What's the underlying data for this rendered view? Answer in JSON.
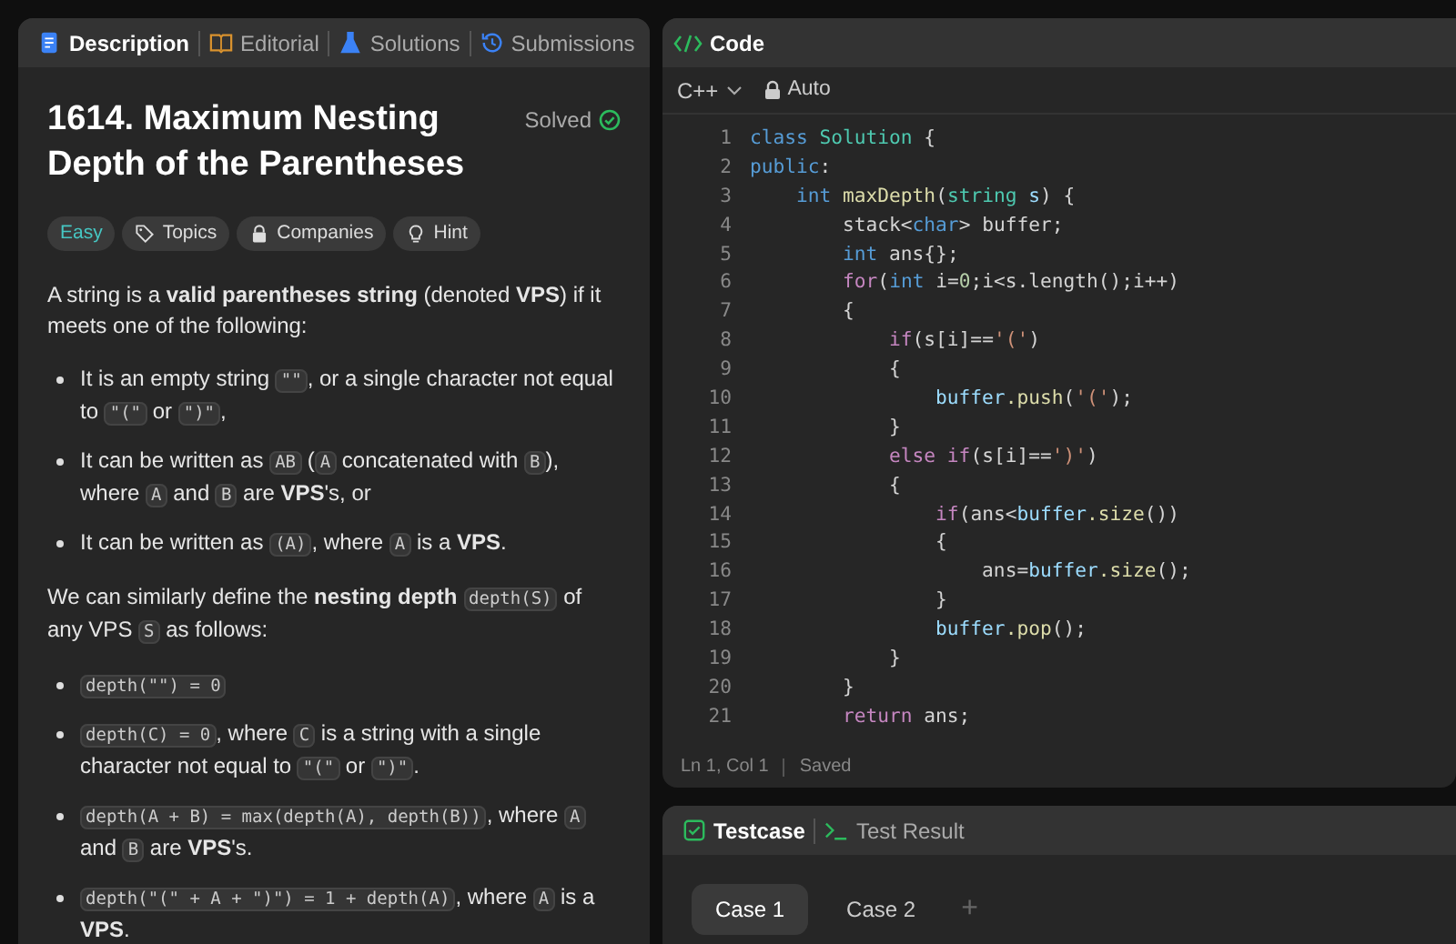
{
  "left_panel": {
    "tabs": [
      {
        "label": "Description",
        "selected": true
      },
      {
        "label": "Editorial",
        "selected": false
      },
      {
        "label": "Solutions",
        "selected": false
      },
      {
        "label": "Submissions",
        "selected": false
      }
    ],
    "title": "1614. Maximum Nesting Depth of the Parentheses",
    "status": "Solved",
    "tags": [
      {
        "label": "Easy",
        "kind": "difficulty"
      },
      {
        "label": "Topics",
        "kind": "tag"
      },
      {
        "label": "Companies",
        "kind": "lock"
      },
      {
        "label": "Hint",
        "kind": "bulb"
      }
    ],
    "description": [
      {
        "kind": "para",
        "segments": [
          {
            "kind": "text",
            "t": "A string is a "
          },
          {
            "kind": "bold",
            "t": "valid parentheses string"
          },
          {
            "kind": "text",
            "t": " (denoted "
          },
          {
            "kind": "bold",
            "t": "VPS"
          },
          {
            "kind": "text",
            "t": ") if it meets one of the following:"
          }
        ]
      },
      {
        "kind": "list",
        "items": [
          [
            {
              "kind": "text",
              "t": "It is an empty string "
            },
            {
              "kind": "code",
              "t": "\"\""
            },
            {
              "kind": "text",
              "t": ", or a single character not equal to "
            },
            {
              "kind": "code",
              "t": "\"(\""
            },
            {
              "kind": "text",
              "t": " or "
            },
            {
              "kind": "code",
              "t": "\")\""
            },
            {
              "kind": "text",
              "t": ","
            }
          ],
          [
            {
              "kind": "text",
              "t": "It can be written as "
            },
            {
              "kind": "code",
              "t": "AB"
            },
            {
              "kind": "text",
              "t": " ("
            },
            {
              "kind": "code",
              "t": "A"
            },
            {
              "kind": "text",
              "t": " concatenated with "
            },
            {
              "kind": "code",
              "t": "B"
            },
            {
              "kind": "text",
              "t": "), where "
            },
            {
              "kind": "code",
              "t": "A"
            },
            {
              "kind": "text",
              "t": " and "
            },
            {
              "kind": "code",
              "t": "B"
            },
            {
              "kind": "text",
              "t": " are "
            },
            {
              "kind": "bold",
              "t": "VPS"
            },
            {
              "kind": "text",
              "t": "'s, or"
            }
          ],
          [
            {
              "kind": "text",
              "t": "It can be written as "
            },
            {
              "kind": "code",
              "t": "(A)"
            },
            {
              "kind": "text",
              "t": ", where "
            },
            {
              "kind": "code",
              "t": "A"
            },
            {
              "kind": "text",
              "t": " is a "
            },
            {
              "kind": "bold",
              "t": "VPS"
            },
            {
              "kind": "text",
              "t": "."
            }
          ]
        ]
      },
      {
        "kind": "para",
        "segments": [
          {
            "kind": "text",
            "t": "We can similarly define the "
          },
          {
            "kind": "bold",
            "t": "nesting depth "
          },
          {
            "kind": "code",
            "t": "depth(S)"
          },
          {
            "kind": "text",
            "t": " of any VPS "
          },
          {
            "kind": "code",
            "t": "S"
          },
          {
            "kind": "text",
            "t": " as follows:"
          }
        ]
      },
      {
        "kind": "list",
        "items": [
          [
            {
              "kind": "code",
              "t": "depth(\"\") = 0"
            }
          ],
          [
            {
              "kind": "code",
              "t": "depth(C) = 0"
            },
            {
              "kind": "text",
              "t": ", where "
            },
            {
              "kind": "code",
              "t": "C"
            },
            {
              "kind": "text",
              "t": " is a string with a single character not equal to "
            },
            {
              "kind": "code",
              "t": "\"(\""
            },
            {
              "kind": "text",
              "t": " or "
            },
            {
              "kind": "code",
              "t": "\")\""
            },
            {
              "kind": "text",
              "t": "."
            }
          ],
          [
            {
              "kind": "code",
              "t": "depth(A + B) = max(depth(A), depth(B))"
            },
            {
              "kind": "text",
              "t": ", where "
            },
            {
              "kind": "code",
              "t": "A"
            },
            {
              "kind": "text",
              "t": " and "
            },
            {
              "kind": "code",
              "t": "B"
            },
            {
              "kind": "text",
              "t": " are "
            },
            {
              "kind": "bold",
              "t": "VPS"
            },
            {
              "kind": "text",
              "t": "'s."
            }
          ],
          [
            {
              "kind": "code",
              "t": "depth(\"(\" + A + \")\") = 1 + depth(A)"
            },
            {
              "kind": "text",
              "t": ", where "
            },
            {
              "kind": "code",
              "t": "A"
            },
            {
              "kind": "text",
              "t": " is a "
            },
            {
              "kind": "bold",
              "t": "VPS"
            },
            {
              "kind": "text",
              "t": "."
            }
          ]
        ]
      }
    ]
  },
  "code_panel": {
    "title": "Code",
    "language": "C++",
    "mode": "Auto",
    "lines": [
      {
        "n": "1",
        "tokens": [
          {
            "kind": "kw",
            "t": "class"
          },
          {
            "kind": "type",
            "t": " Solution"
          },
          {
            "kind": "plain",
            "t": " {"
          }
        ]
      },
      {
        "n": "2",
        "tokens": [
          {
            "kind": "kw",
            "t": "public"
          },
          {
            "kind": "plain",
            "t": ":"
          }
        ]
      },
      {
        "n": "3",
        "tokens": [
          {
            "kind": "kw",
            "t": "    int"
          },
          {
            "kind": "fn",
            "t": " maxDepth"
          },
          {
            "kind": "plain",
            "t": "("
          },
          {
            "kind": "type",
            "t": "string"
          },
          {
            "kind": "var",
            "t": " s"
          },
          {
            "kind": "plain",
            "t": ") {"
          }
        ]
      },
      {
        "n": "4",
        "tokens": [
          {
            "kind": "plain",
            "t": "        stack<"
          },
          {
            "kind": "kw",
            "t": "char"
          },
          {
            "kind": "plain",
            "t": "> buffer;"
          }
        ]
      },
      {
        "n": "5",
        "tokens": [
          {
            "kind": "kw",
            "t": "        int"
          },
          {
            "kind": "plain",
            "t": " ans{};"
          }
        ]
      },
      {
        "n": "6",
        "tokens": [
          {
            "kind": "ctrl",
            "t": "        for"
          },
          {
            "kind": "plain",
            "t": "("
          },
          {
            "kind": "kw",
            "t": "int"
          },
          {
            "kind": "plain",
            "t": " i="
          },
          {
            "kind": "num",
            "t": "0"
          },
          {
            "kind": "plain",
            "t": ";i<s.length();i++)"
          }
        ]
      },
      {
        "n": "7",
        "tokens": [
          {
            "kind": "plain",
            "t": "        {"
          }
        ]
      },
      {
        "n": "8",
        "tokens": [
          {
            "kind": "ctrl",
            "t": "            if"
          },
          {
            "kind": "plain",
            "t": "(s[i]=="
          },
          {
            "kind": "str",
            "t": "'('"
          },
          {
            "kind": "plain",
            "t": ")"
          }
        ]
      },
      {
        "n": "9",
        "tokens": [
          {
            "kind": "plain",
            "t": "            {"
          }
        ]
      },
      {
        "n": "10",
        "tokens": [
          {
            "kind": "var",
            "t": "                buffer"
          },
          {
            "kind": "fn",
            "t": ".push"
          },
          {
            "kind": "plain",
            "t": "("
          },
          {
            "kind": "str",
            "t": "'('"
          },
          {
            "kind": "plain",
            "t": ");"
          }
        ]
      },
      {
        "n": "11",
        "tokens": [
          {
            "kind": "plain",
            "t": "            }"
          }
        ]
      },
      {
        "n": "12",
        "tokens": [
          {
            "kind": "ctrl",
            "t": "            else if"
          },
          {
            "kind": "plain",
            "t": "(s[i]=="
          },
          {
            "kind": "str",
            "t": "')'"
          },
          {
            "kind": "plain",
            "t": ")"
          }
        ]
      },
      {
        "n": "13",
        "tokens": [
          {
            "kind": "plain",
            "t": "            {"
          }
        ]
      },
      {
        "n": "14",
        "tokens": [
          {
            "kind": "ctrl",
            "t": "                if"
          },
          {
            "kind": "plain",
            "t": "(ans<"
          },
          {
            "kind": "var",
            "t": "buffer"
          },
          {
            "kind": "fn",
            "t": ".size"
          },
          {
            "kind": "plain",
            "t": "())"
          }
        ]
      },
      {
        "n": "15",
        "tokens": [
          {
            "kind": "plain",
            "t": "                {"
          }
        ]
      },
      {
        "n": "16",
        "tokens": [
          {
            "kind": "plain",
            "t": "                    ans="
          },
          {
            "kind": "var",
            "t": "buffer"
          },
          {
            "kind": "fn",
            "t": ".size"
          },
          {
            "kind": "plain",
            "t": "();"
          }
        ]
      },
      {
        "n": "17",
        "tokens": [
          {
            "kind": "plain",
            "t": "                }"
          }
        ]
      },
      {
        "n": "18",
        "tokens": [
          {
            "kind": "var",
            "t": "                buffer"
          },
          {
            "kind": "fn",
            "t": ".pop"
          },
          {
            "kind": "plain",
            "t": "();"
          }
        ]
      },
      {
        "n": "19",
        "tokens": [
          {
            "kind": "plain",
            "t": "            }"
          }
        ]
      },
      {
        "n": "20",
        "tokens": [
          {
            "kind": "plain",
            "t": "        }"
          }
        ]
      },
      {
        "n": "21",
        "tokens": [
          {
            "kind": "ctrl",
            "t": "        return"
          },
          {
            "kind": "plain",
            "t": " ans;"
          }
        ]
      }
    ],
    "status_bar": {
      "position": "Ln 1, Col 1",
      "save_state": "Saved"
    }
  },
  "test_panel": {
    "tabs": [
      {
        "label": "Testcase",
        "selected": true
      },
      {
        "label": "Test Result",
        "selected": false
      }
    ],
    "cases": [
      {
        "label": "Case 1",
        "selected": true
      },
      {
        "label": "Case 2",
        "selected": false
      }
    ],
    "add_label": "+"
  }
}
